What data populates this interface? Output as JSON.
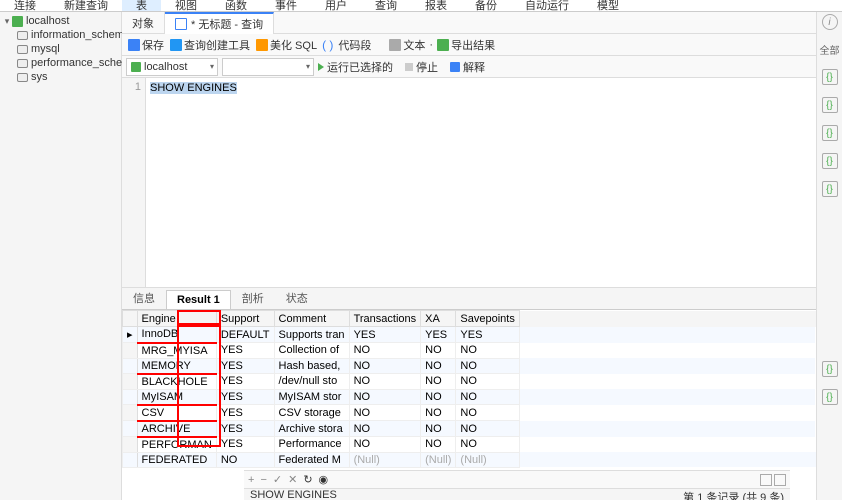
{
  "menu": [
    "连接",
    "新建查询",
    "表",
    "视图",
    "函数",
    "事件",
    "用户",
    "查询",
    "报表",
    "备份",
    "自动运行",
    "模型"
  ],
  "sidebar": {
    "root": "localhost",
    "items": [
      "information_schema",
      "mysql",
      "performance_schema",
      "sys"
    ]
  },
  "tabs": {
    "objects": "对象",
    "active": "* 无标题 - 查询"
  },
  "toolbar": {
    "save": "保存",
    "qbuilder": "查询创建工具",
    "beautify": "美化 SQL",
    "snippet": "代码段",
    "text": "文本",
    "export": "导出结果"
  },
  "connrow": {
    "conn": "localhost",
    "db": "",
    "run": "运行已选择的",
    "stop": "停止",
    "explain": "解释"
  },
  "editor": {
    "line": "1",
    "sql": "SHOW ENGINES"
  },
  "result_tabs": [
    "信息",
    "Result 1",
    "剖析",
    "状态"
  ],
  "columns": [
    "Engine",
    "Support",
    "Comment",
    "Transactions",
    "XA",
    "Savepoints"
  ],
  "rows": [
    {
      "Engine": "InnoDB",
      "Support": "DEFAULT",
      "Comment": "Supports tran",
      "Transactions": "YES",
      "XA": "YES",
      "Savepoints": "YES",
      "hilite": true,
      "underline": true
    },
    {
      "Engine": "MRG_MYISA",
      "Support": "YES",
      "Comment": "Collection of",
      "Transactions": "NO",
      "XA": "NO",
      "Savepoints": "NO"
    },
    {
      "Engine": "MEMORY",
      "Support": "YES",
      "Comment": "Hash based,",
      "Transactions": "NO",
      "XA": "NO",
      "Savepoints": "NO",
      "hilite": true,
      "underline": true
    },
    {
      "Engine": "BLACKHOLE",
      "Support": "YES",
      "Comment": "/dev/null sto",
      "Transactions": "NO",
      "XA": "NO",
      "Savepoints": "NO"
    },
    {
      "Engine": "MyISAM",
      "Support": "YES",
      "Comment": "MyISAM stor",
      "Transactions": "NO",
      "XA": "NO",
      "Savepoints": "NO",
      "hilite": true,
      "underline": true
    },
    {
      "Engine": "CSV",
      "Support": "YES",
      "Comment": "CSV storage",
      "Transactions": "NO",
      "XA": "NO",
      "Savepoints": "NO",
      "underline": true
    },
    {
      "Engine": "ARCHIVE",
      "Support": "YES",
      "Comment": "Archive stora",
      "Transactions": "NO",
      "XA": "NO",
      "Savepoints": "NO",
      "hilite": true,
      "underline": true
    },
    {
      "Engine": "PERFORMAN",
      "Support": "YES",
      "Comment": "Performance",
      "Transactions": "NO",
      "XA": "NO",
      "Savepoints": "NO"
    },
    {
      "Engine": "FEDERATED",
      "Support": "NO",
      "Comment": "Federated M",
      "Transactions": "(Null)",
      "XA": "(Null)",
      "Savepoints": "(Null)",
      "hilite": true
    }
  ],
  "rightbar": {
    "label": "全部",
    "items": [
      "{}",
      "{}",
      "{}",
      "{}",
      "{}",
      "{}",
      "{}"
    ]
  },
  "status": {
    "left": "SHOW ENGINES",
    "right": "第 1 条记录 (共 9 条)"
  }
}
